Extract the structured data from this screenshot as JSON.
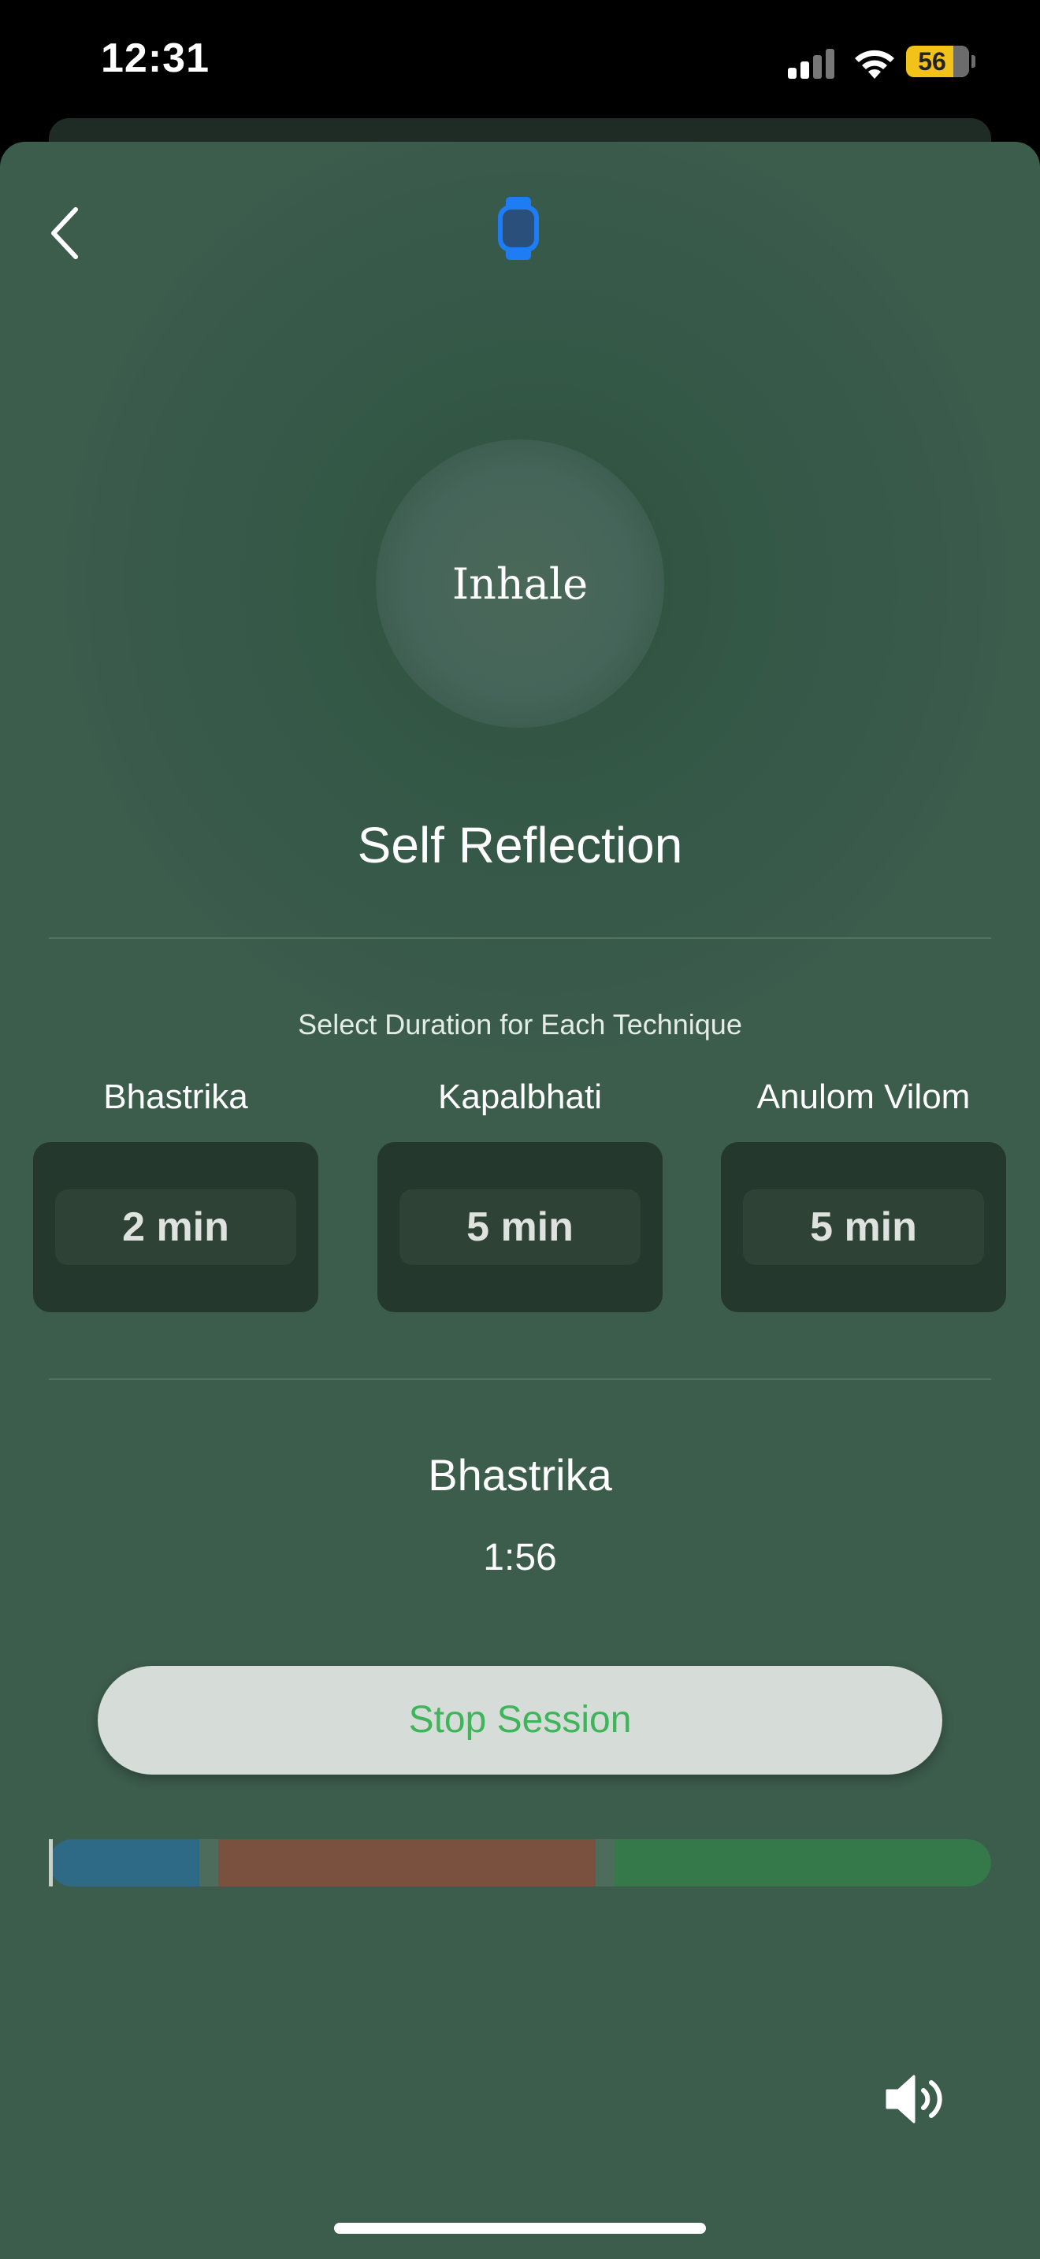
{
  "status_bar": {
    "time": "12:31",
    "battery": "56"
  },
  "session": {
    "breath_phase": "Inhale",
    "title": "Self Reflection"
  },
  "durations": {
    "heading": "Select Duration for Each Technique",
    "techniques": [
      {
        "name": "Bhastrika",
        "value": "2 min"
      },
      {
        "name": "Kapalbhati",
        "value": "5 min"
      },
      {
        "name": "Anulom Vilom",
        "value": "5 min"
      }
    ]
  },
  "current": {
    "technique": "Bhastrika",
    "timer": "1:56"
  },
  "actions": {
    "stop_label": "Stop Session"
  },
  "progress": {
    "segments": [
      {
        "name": "Bhastrika",
        "minutes": 2,
        "color": "#2e6a86"
      },
      {
        "name": "gap",
        "minutes": 0.25,
        "color": "#4d6c5c"
      },
      {
        "name": "Kapalbhati",
        "minutes": 5,
        "color": "#7a503e"
      },
      {
        "name": "gap",
        "minutes": 0.25,
        "color": "#4d6c5c"
      },
      {
        "name": "Anulom Vilom",
        "minutes": 5,
        "color": "#35784a"
      }
    ]
  },
  "colors": {
    "accent": "#3fb45a",
    "watch": "#1e7cf5"
  },
  "icons": [
    "back-chevron-icon",
    "watch-icon",
    "speaker-icon"
  ]
}
